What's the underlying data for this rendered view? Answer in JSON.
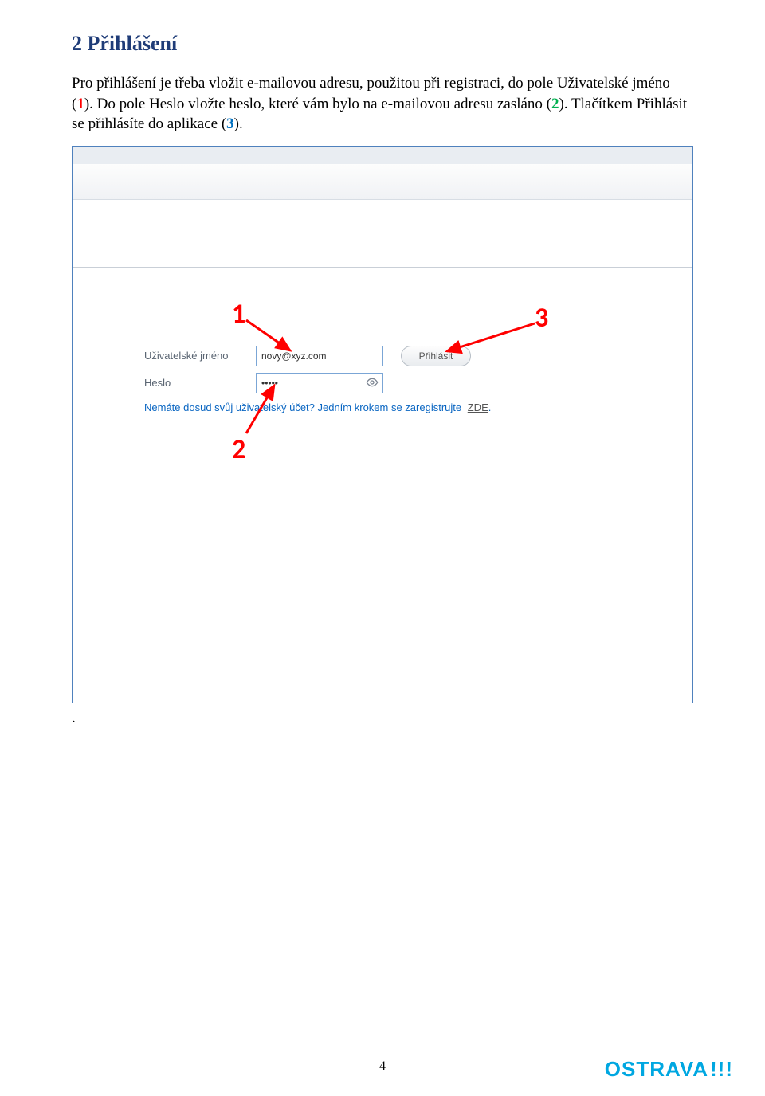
{
  "heading": "2  Přihlášení",
  "para": {
    "t1": "Pro přihlášení je třeba vložit e-mailovou adresu, použitou při registraci, do pole Uživatelské jméno (",
    "r1": "1",
    "t2": "). Do pole Heslo vložte heslo, které vám bylo na e-mailovou adresu zasláno (",
    "r2": "2",
    "t3": "). Tlačítkem Přihlásit se přihlásíte do aplikace (",
    "r3": "3",
    "t4": ")."
  },
  "form": {
    "username_label": "Uživatelské jméno",
    "username_value": "novy@xyz.com",
    "password_label": "Heslo",
    "password_value": "•••••",
    "login_label": "Přihlásit",
    "register_prompt": "Nemáte dosud svůj uživatelský účet? Jedním krokem se zaregistrujte ",
    "register_link": "ZDE",
    "register_suffix": "."
  },
  "anno": {
    "n1": "1",
    "n2": "2",
    "n3": "3"
  },
  "dot": ".",
  "page_number": "4",
  "brand": {
    "text": "OSTRAVA",
    "bangs": "!!!"
  }
}
